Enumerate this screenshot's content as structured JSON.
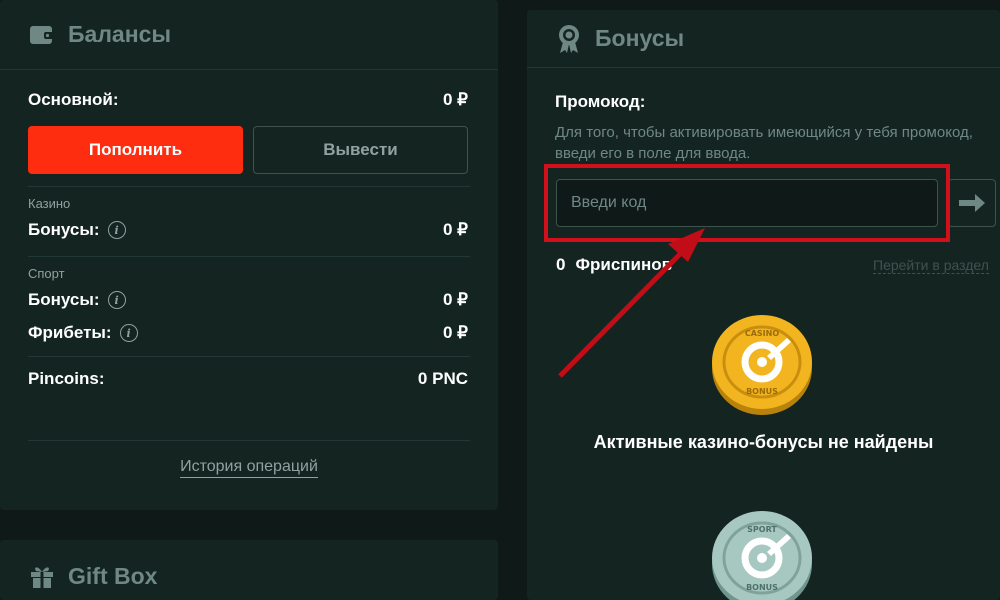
{
  "balances": {
    "title": "Балансы",
    "main_label": "Основной:",
    "main_value": "0 ₽",
    "deposit_label": "Пополнить",
    "withdraw_label": "Вывести",
    "casino_caption": "Казино",
    "casino_bonus_label": "Бонусы:",
    "casino_bonus_value": "0 ₽",
    "sport_caption": "Спорт",
    "sport_bonus_label": "Бонусы:",
    "sport_bonus_value": "0 ₽",
    "freebets_label": "Фрибеты:",
    "freebets_value": "0 ₽",
    "pincoins_label": "Pincoins:",
    "pincoins_value": "0 PNC",
    "history_label": "История операций"
  },
  "giftbox": {
    "title": "Gift Box"
  },
  "bonuses": {
    "title": "Бонусы",
    "promo_label": "Промокод:",
    "promo_hint": "Для того, чтобы активировать имеющийся у тебя промокод, введи его в поле для ввода.",
    "promo_placeholder": "Введи код",
    "freespins_count": "0",
    "freespins_label": "Фриспинов",
    "goto_section_label": "Перейти в раздел",
    "casino_coin_text": "CASINO · BONUS",
    "sport_coin_text": "SPORT · BONUS",
    "no_casino_bonuses": "Активные казино-бонусы не найдены"
  },
  "colors": {
    "accent": "#ff2d0f",
    "background": "#0f1a18",
    "panel": "#142421",
    "annotation": "#d0101a"
  },
  "icons": [
    "wallet-icon",
    "gift-icon",
    "award-icon",
    "info-icon",
    "arrow-right-icon",
    "casino-coin-icon",
    "sport-coin-icon"
  ]
}
